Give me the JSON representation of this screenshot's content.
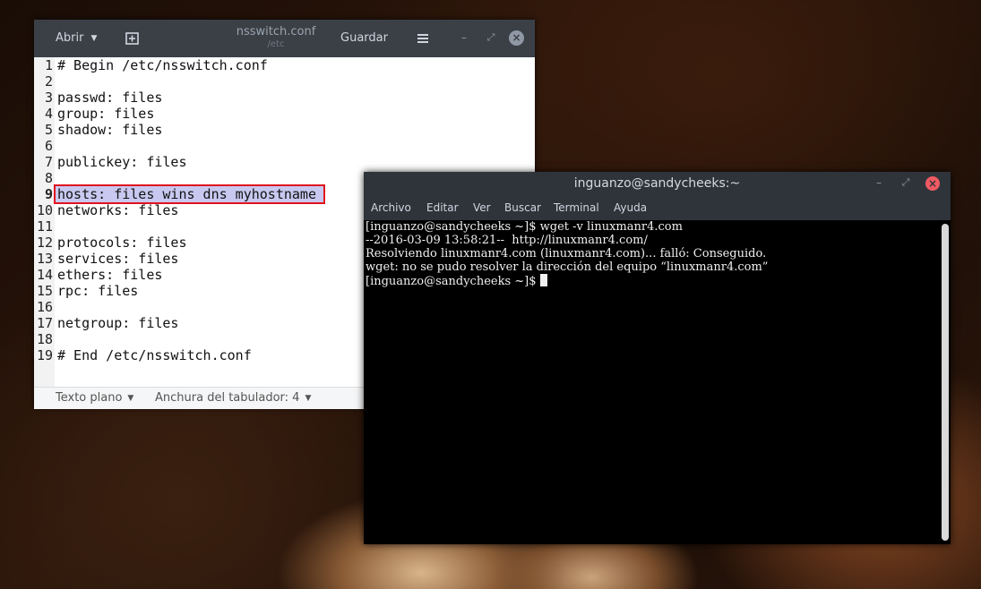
{
  "gedit": {
    "open_label": "Abrir",
    "save_label": "Guardar",
    "doc_title": "nsswitch.conf",
    "doc_path": "/etc",
    "current_line": 9,
    "lines": [
      {
        "num": "1",
        "text": "# Begin /etc/nsswitch.conf"
      },
      {
        "num": "2",
        "text": ""
      },
      {
        "num": "3",
        "text": "passwd: files"
      },
      {
        "num": "4",
        "text": "group: files"
      },
      {
        "num": "5",
        "text": "shadow: files"
      },
      {
        "num": "6",
        "text": ""
      },
      {
        "num": "7",
        "text": "publickey: files"
      },
      {
        "num": "8",
        "text": ""
      },
      {
        "num": "9",
        "text": "hosts: files wins dns myhostname"
      },
      {
        "num": "10",
        "text": "networks: files"
      },
      {
        "num": "11",
        "text": ""
      },
      {
        "num": "12",
        "text": "protocols: files"
      },
      {
        "num": "13",
        "text": "services: files"
      },
      {
        "num": "14",
        "text": "ethers: files"
      },
      {
        "num": "15",
        "text": "rpc: files"
      },
      {
        "num": "16",
        "text": ""
      },
      {
        "num": "17",
        "text": "netgroup: files"
      },
      {
        "num": "18",
        "text": ""
      },
      {
        "num": "19",
        "text": "# End /etc/nsswitch.conf"
      }
    ],
    "status": {
      "language": "Texto plano",
      "tab_width": "Anchura del tabulador: 4"
    }
  },
  "terminal": {
    "title": "inguanzo@sandycheeks:~",
    "menu": [
      "Archivo",
      "Editar",
      "Ver",
      "Buscar",
      "Terminal",
      "Ayuda"
    ],
    "lines": [
      "[inguanzo@sandycheeks ~]$ wget -v linuxmanr4.com",
      "--2016-03-09 13:58:21--  http://linuxmanr4.com/",
      "Resolviendo linuxmanr4.com (linuxmanr4.com)... falló: Conseguido.",
      "wget: no se pudo resolver la dirección del equipo “linuxmanr4.com”"
    ],
    "prompt": "[inguanzo@sandycheeks ~]$"
  },
  "colors": {
    "highlight_box": "#e0141e",
    "selection": "#c8c8f0",
    "titlebar": "#3b4047",
    "terminal_close": "#f05a63"
  }
}
